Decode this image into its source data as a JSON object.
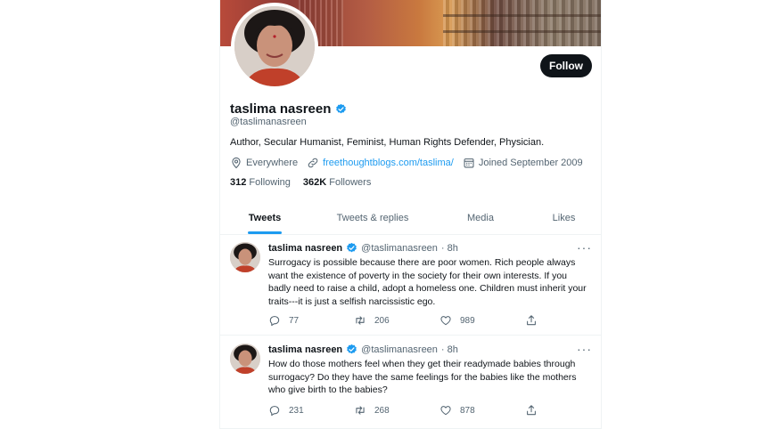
{
  "profile": {
    "name": "taslima nasreen",
    "handle": "@taslimanasreen",
    "bio": "Author, Secular Humanist, Feminist, Human Rights Defender, Physician.",
    "location": "Everywhere",
    "website": "freethoughtblogs.com/taslima/",
    "joined": "Joined September 2009",
    "following_count": "312",
    "following_label": "Following",
    "followers_count": "362K",
    "followers_label": "Followers",
    "follow_button": "Follow"
  },
  "icons": {
    "verified": "verified-badge-icon",
    "location": "location-pin-icon",
    "link": "link-icon",
    "calendar": "calendar-icon",
    "reply": "reply-icon",
    "retweet": "retweet-icon",
    "like": "heart-icon",
    "share": "share-icon",
    "more": "more-icon"
  },
  "colors": {
    "accent": "#1d9bf0",
    "text": "#0f1419",
    "muted": "#536471",
    "button": "#0f1419"
  },
  "tabs": [
    {
      "label": "Tweets",
      "active": true
    },
    {
      "label": "Tweets & replies",
      "active": false
    },
    {
      "label": "Media",
      "active": false
    },
    {
      "label": "Likes",
      "active": false
    }
  ],
  "tweets": [
    {
      "name": "taslima nasreen",
      "handle": "@taslimanasreen",
      "time": "· 8h",
      "text": "Surrogacy is possible because there are poor women. Rich people always want the existence of poverty in the society for their own interests. If you badly need to raise a child, adopt a homeless one. Children must inherit your traits---it is just a selfish narcissistic ego.",
      "replies": "77",
      "retweets": "206",
      "likes": "989",
      "more": "···"
    },
    {
      "name": "taslima nasreen",
      "handle": "@taslimanasreen",
      "time": "· 8h",
      "text": "How do those mothers feel when they get their readymade babies through surrogacy? Do they have the same feelings  for the babies  like the mothers who give birth to the babies?",
      "replies": "231",
      "retweets": "268",
      "likes": "878",
      "more": "···"
    }
  ]
}
